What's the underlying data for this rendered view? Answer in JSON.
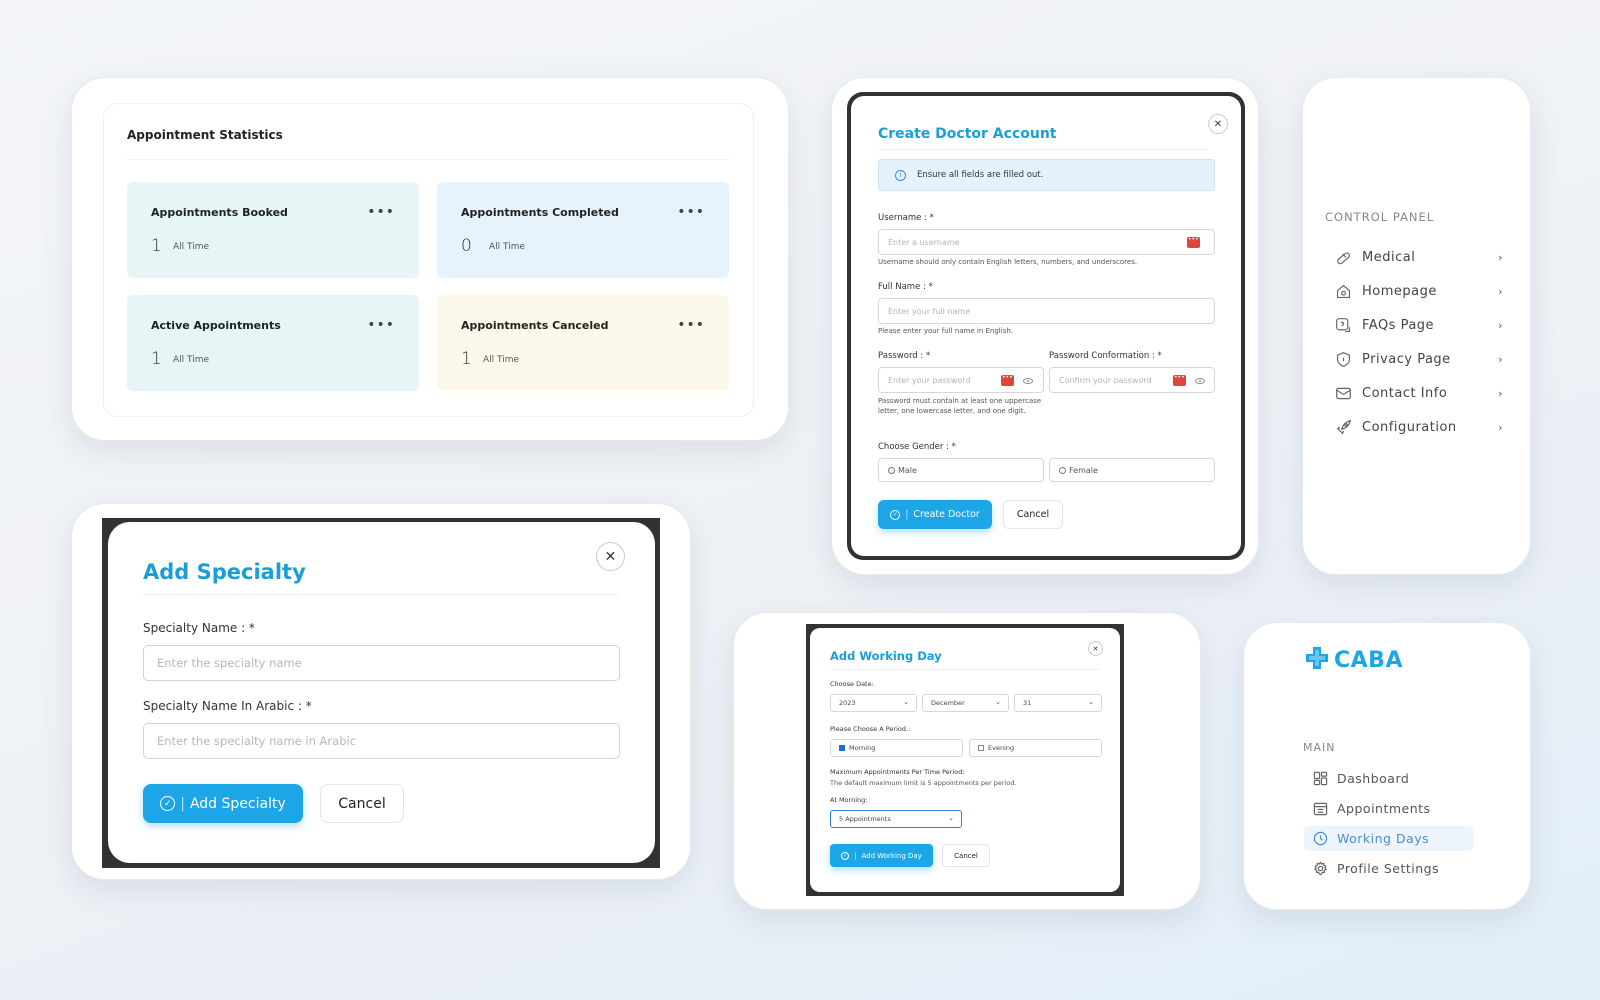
{
  "stats": {
    "title": "Appointment Statistics",
    "items": [
      {
        "label": "Appointments Booked",
        "value": "1",
        "period": "All Time",
        "color": "#e6f5f6"
      },
      {
        "label": "Appointments Completed",
        "value": "0",
        "period": "All Time",
        "color": "#e7f3fc"
      },
      {
        "label": "Active Appointments",
        "value": "1",
        "period": "All Time",
        "color": "#e6f5f6"
      },
      {
        "label": "Appointments Canceled",
        "value": "1",
        "period": "All Time",
        "color": "#fdf9ea"
      }
    ],
    "more_icon": "more-dots-icon"
  },
  "doctor": {
    "title": "Create Doctor Account",
    "alert": "Ensure all fields are filled out.",
    "username_label": "Username : *",
    "username_placeholder": "Enter a username",
    "username_hint": "Username should only contain English letters, numbers, and underscores.",
    "fullname_label": "Full Name : *",
    "fullname_placeholder": "Enter your full name",
    "fullname_hint": "Please enter your full name in English.",
    "password_label": "Password : *",
    "password_placeholder": "Enter your password",
    "password_hint": "Password must contain at least one uppercase letter, one lowercase letter, and one digit.",
    "confirm_label": "Password Conformation : *",
    "confirm_placeholder": "Confirm your password",
    "gender_label": "Choose Gender : *",
    "male": "Male",
    "female": "Female",
    "submit": "Create Doctor",
    "cancel": "Cancel"
  },
  "control_panel": {
    "title": "CONTROL PANEL",
    "items": [
      {
        "label": "Medical",
        "icon": "pill-icon"
      },
      {
        "label": "Homepage",
        "icon": "home-icon"
      },
      {
        "label": "FAQs Page",
        "icon": "faq-icon"
      },
      {
        "label": "Privacy Page",
        "icon": "shield-icon"
      },
      {
        "label": "Contact Info",
        "icon": "mail-icon"
      },
      {
        "label": "Configuration",
        "icon": "rocket-icon"
      }
    ]
  },
  "specialty": {
    "title": "Add Specialty",
    "name_label": "Specialty Name : *",
    "name_placeholder": "Enter the specialty name",
    "arabic_label": "Specialty Name In Arabic : *",
    "arabic_placeholder": "Enter the specialty name in Arabic",
    "submit": "Add Specialty",
    "cancel": "Cancel"
  },
  "working_day": {
    "title": "Add Working Day",
    "date_label": "Choose Date:",
    "year": "2023",
    "month": "December",
    "day": "31",
    "period_label": "Please Choose A Period.:",
    "morning": "Morning",
    "evening": "Evening",
    "max_label": "Maximum Appointments Per Time Period:",
    "max_hint": "The default maximum limit is 5 appointments per period.",
    "at_morning_label": "At Morning:",
    "at_morning_value": "5 Appointments",
    "submit": "Add Working Day",
    "cancel": "Cancel"
  },
  "main_nav": {
    "logo": "CABA",
    "title": "MAIN",
    "items": [
      {
        "label": "Dashboard",
        "icon": "dashboard-icon",
        "active": false
      },
      {
        "label": "Appointments",
        "icon": "calendar-icon",
        "active": false
      },
      {
        "label": "Working Days",
        "icon": "clock-icon",
        "active": true
      },
      {
        "label": "Profile Settings",
        "icon": "gear-icon",
        "active": false
      }
    ]
  },
  "colors": {
    "accent": "#1ca6e8",
    "active_nav_bg": "#eef4fb"
  }
}
